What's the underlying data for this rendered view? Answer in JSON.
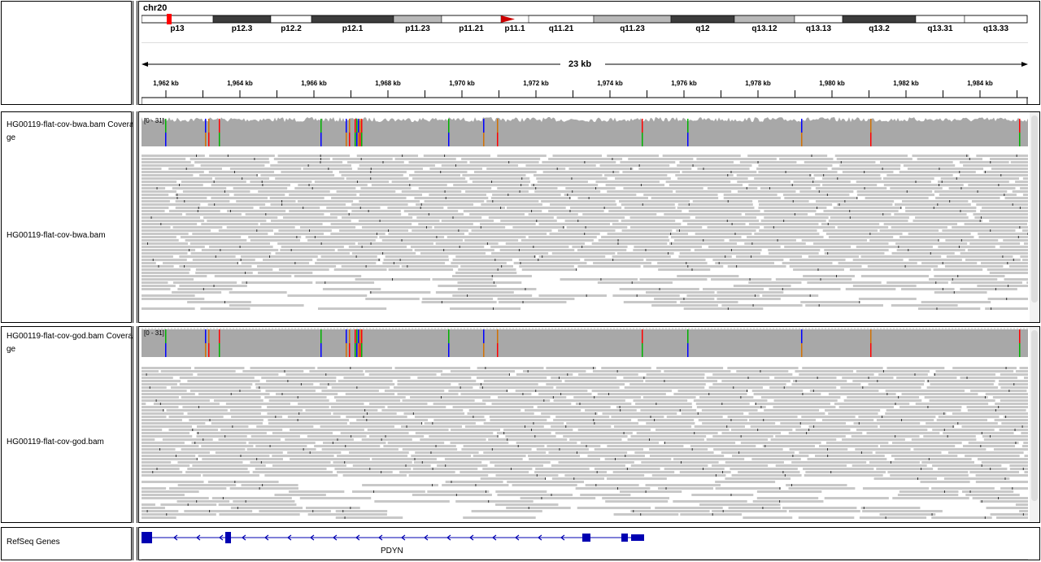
{
  "header": {
    "chromosome": "chr20",
    "bands": [
      {
        "name": "p13",
        "start": 0,
        "end": 88,
        "stain": "white"
      },
      {
        "name": "p12.3",
        "start": 88,
        "end": 159,
        "stain": "dark"
      },
      {
        "name": "p12.2",
        "start": 159,
        "end": 209,
        "stain": "white"
      },
      {
        "name": "p12.1",
        "start": 209,
        "end": 310,
        "stain": "dark"
      },
      {
        "name": "p11.23",
        "start": 310,
        "end": 369,
        "stain": "light"
      },
      {
        "name": "p11.21",
        "start": 369,
        "end": 442,
        "stain": "white"
      },
      {
        "name": "p11.1",
        "start": 442,
        "end": 476,
        "stain": "centromere-p"
      },
      {
        "name": "q11.21",
        "start": 476,
        "end": 556,
        "stain": "white"
      },
      {
        "name": "q11.23",
        "start": 556,
        "end": 651,
        "stain": "light"
      },
      {
        "name": "q12",
        "start": 651,
        "end": 729,
        "stain": "dark"
      },
      {
        "name": "q13.12",
        "start": 729,
        "end": 803,
        "stain": "light"
      },
      {
        "name": "q13.13",
        "start": 803,
        "end": 862,
        "stain": "white"
      },
      {
        "name": "q13.2",
        "start": 862,
        "end": 952,
        "stain": "dark"
      },
      {
        "name": "q13.31",
        "start": 952,
        "end": 1012,
        "stain": "white"
      },
      {
        "name": "q13.33",
        "start": 1012,
        "end": 1089,
        "stain": "white"
      }
    ],
    "span_label": "23 kb",
    "ruler_ticks": [
      "1,962 kb",
      "1,964 kb",
      "1,966 kb",
      "1,968 kb",
      "1,970 kb",
      "1,972 kb",
      "1,974 kb",
      "1,976 kb",
      "1,978 kb",
      "1,980 kb",
      "1,982 kb",
      "1,984 kb"
    ]
  },
  "tracks": {
    "bwa_coverage": {
      "label": "HG00119-flat-cov-bwa.bam Coverage",
      "range": "[0 - 31]"
    },
    "bwa_alignment": {
      "label": "HG00119-flat-cov-bwa.bam"
    },
    "god_coverage": {
      "label": "HG00119-flat-cov-god.bam Coverage",
      "range": "[0 - 31]"
    },
    "god_alignment": {
      "label": "HG00119-flat-cov-god.bam"
    },
    "refseq": {
      "label": "RefSeq Genes",
      "gene_name": "PDYN"
    }
  },
  "colors": {
    "coverage_gray": "#a8a8a8",
    "read_gray": "#c8c8c8",
    "gene_blue": "#0000b2",
    "centromere_red": "#cc0000",
    "band_dark": "#3c3c3c",
    "band_light": "#b8b8b8",
    "base_A": "#00b000",
    "base_C": "#0000ff",
    "base_G": "#d17105",
    "base_T": "#ff0000"
  }
}
